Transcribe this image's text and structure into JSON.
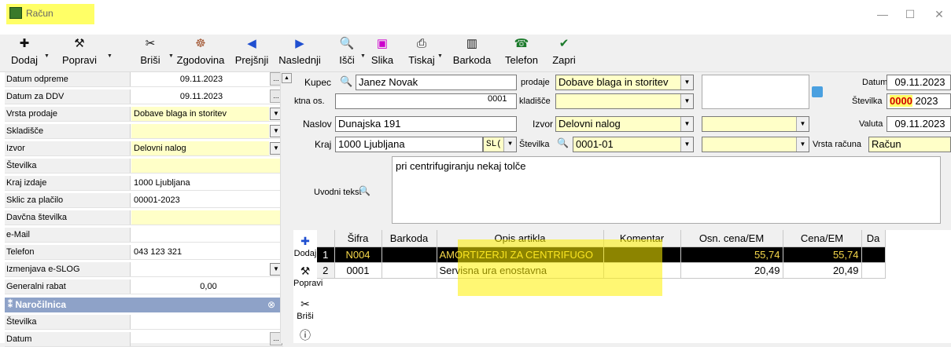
{
  "window": {
    "title": "Račun",
    "minimize": "—",
    "maximize": "☐",
    "close": "✕"
  },
  "toolbar": [
    {
      "id": "dodaj",
      "label": "Dodaj",
      "icon": "plus-icon",
      "glyph": "✚",
      "color": "#111"
    },
    {
      "id": "popravi",
      "label": "Popravi",
      "icon": "hammer-icon",
      "glyph": "⚒",
      "color": "#111"
    },
    {
      "id": "brisi",
      "label": "Briši",
      "icon": "scissors-icon",
      "glyph": "✂",
      "color": "#111"
    },
    {
      "id": "zgodovina",
      "label": "Zgodovina",
      "icon": "history-icon",
      "glyph": "☸",
      "color": "#a0522d"
    },
    {
      "id": "prejsnji",
      "label": "Prejšnji",
      "icon": "arrow-left-icon",
      "glyph": "◀",
      "color": "#1f4fd0"
    },
    {
      "id": "naslednji",
      "label": "Naslednji",
      "icon": "arrow-right-icon",
      "glyph": "▶",
      "color": "#1f4fd0"
    },
    {
      "id": "isci",
      "label": "Išči",
      "icon": "search-icon",
      "glyph": "🔍",
      "color": "#1f4fd0"
    },
    {
      "id": "slika",
      "label": "Slika",
      "icon": "image-icon",
      "glyph": "▣",
      "color": "#cc00cc"
    },
    {
      "id": "tiskaj",
      "label": "Tiskaj",
      "icon": "printer-icon",
      "glyph": "⎙",
      "color": "#111"
    },
    {
      "id": "barkoda",
      "label": "Barkoda",
      "icon": "barcode-icon",
      "glyph": "▥",
      "color": "#111"
    },
    {
      "id": "telefon",
      "label": "Telefon",
      "icon": "phone-icon",
      "glyph": "☎",
      "color": "#1b7a2b"
    },
    {
      "id": "zapri",
      "label": "Zapri",
      "icon": "check-icon",
      "glyph": "✔",
      "color": "#1b7a2b"
    }
  ],
  "props": [
    {
      "label": "Datum odpreme",
      "value": "09.11.2023",
      "align": "center",
      "yellow": false,
      "ctl": "ellipsis"
    },
    {
      "label": "Datum za DDV",
      "value": "09.11.2023",
      "align": "center",
      "yellow": false,
      "ctl": "ellipsis"
    },
    {
      "label": "Vrsta prodaje",
      "value": "Dobave blaga in storitev",
      "align": "left",
      "yellow": true,
      "ctl": "dropdown"
    },
    {
      "label": "Skladišče",
      "value": "",
      "align": "left",
      "yellow": true,
      "ctl": "dropdown"
    },
    {
      "label": "Izvor",
      "value": "Delovni nalog",
      "align": "left",
      "yellow": true,
      "ctl": "dropdown"
    },
    {
      "label": "Številka",
      "value": "",
      "align": "left",
      "yellow": true,
      "ctl": ""
    },
    {
      "label": "Kraj izdaje",
      "value": "1000 Ljubljana",
      "align": "left",
      "yellow": false,
      "ctl": ""
    },
    {
      "label": "Sklic za plačilo",
      "value": "00001-2023",
      "align": "left",
      "yellow": false,
      "ctl": ""
    },
    {
      "label": "Davčna številka",
      "value": "",
      "align": "left",
      "yellow": true,
      "ctl": ""
    },
    {
      "label": "e-Mail",
      "value": "",
      "align": "left",
      "yellow": false,
      "ctl": ""
    },
    {
      "label": "Telefon",
      "value": "043 123 321",
      "align": "left",
      "yellow": false,
      "ctl": ""
    },
    {
      "label": "Izmenjava e-SLOG",
      "value": "",
      "align": "left",
      "yellow": false,
      "ctl": "dropdown"
    },
    {
      "label": "Generalni rabat",
      "value": "0,00",
      "align": "center",
      "yellow": false,
      "ctl": ""
    }
  ],
  "section": {
    "title": "Naročilnica",
    "collapse": "⊗"
  },
  "props2": [
    {
      "label": "Številka",
      "value": "",
      "ctl": ""
    },
    {
      "label": "Datum",
      "value": "",
      "ctl": "ellipsis"
    }
  ],
  "form": {
    "kupec_label": "Kupec",
    "kupec_value": "Janez Novak",
    "kontakt_label": "ktna os.",
    "kontakt_code": "0001",
    "naslov_label": "Naslov",
    "naslov_value": "Dunajska 191",
    "kraj_label": "Kraj",
    "kraj_value": "1000 Ljubljana",
    "kraj_country": "SL(",
    "prodaje_label": "prodaje",
    "prodaje_value": "Dobave blaga in storitev",
    "skladisce_label": "kladišče",
    "skladisce_value": "",
    "izvor_label": "Izvor",
    "izvor_value": "Delovni nalog",
    "stevilka_label": "Številka",
    "stevilka_value": "0001-01",
    "datum_label": "Datum",
    "datum_value": "09.11.2023",
    "st_label": "Številka",
    "st_red": "0000",
    "st_year": "2023",
    "valuta_label": "Valuta",
    "valuta_value": "09.11.2023",
    "vrsta_label": "Vrsta računa",
    "vrsta_value": "Račun",
    "uvod_label": "Uvodni tekst",
    "uvod_value": "pri centrifugiranju nekaj tolče"
  },
  "grid": {
    "headers": [
      "",
      "Šifra",
      "Barkoda",
      "Opis artikla",
      "Komentar",
      "Osn. cena/EM",
      "Cena/EM",
      "Da"
    ],
    "rows": [
      {
        "n": "1",
        "sifra": "N004",
        "barkoda": "",
        "opis": "AMORTIZERJI ZA CENTRIFUGO",
        "komentar": "",
        "osn": "55,74",
        "cena": "55,74",
        "da": ""
      },
      {
        "n": "2",
        "sifra": "0001",
        "barkoda": "",
        "opis": "Servisna ura enostavna",
        "komentar": "",
        "osn": "20,49",
        "cena": "20,49",
        "da": ""
      }
    ]
  },
  "side": [
    {
      "label": "Dodaj",
      "icon": "plus-icon",
      "glyph": "✚",
      "color": "#1f4fd0"
    },
    {
      "label": "Popravi",
      "icon": "hammer-icon",
      "glyph": "⚒",
      "color": "#111"
    },
    {
      "label": "Briši",
      "icon": "scissors-icon",
      "glyph": "✂",
      "color": "#111"
    },
    {
      "label": "",
      "icon": "info-icon",
      "glyph": "ⓘ",
      "color": "#111"
    }
  ]
}
